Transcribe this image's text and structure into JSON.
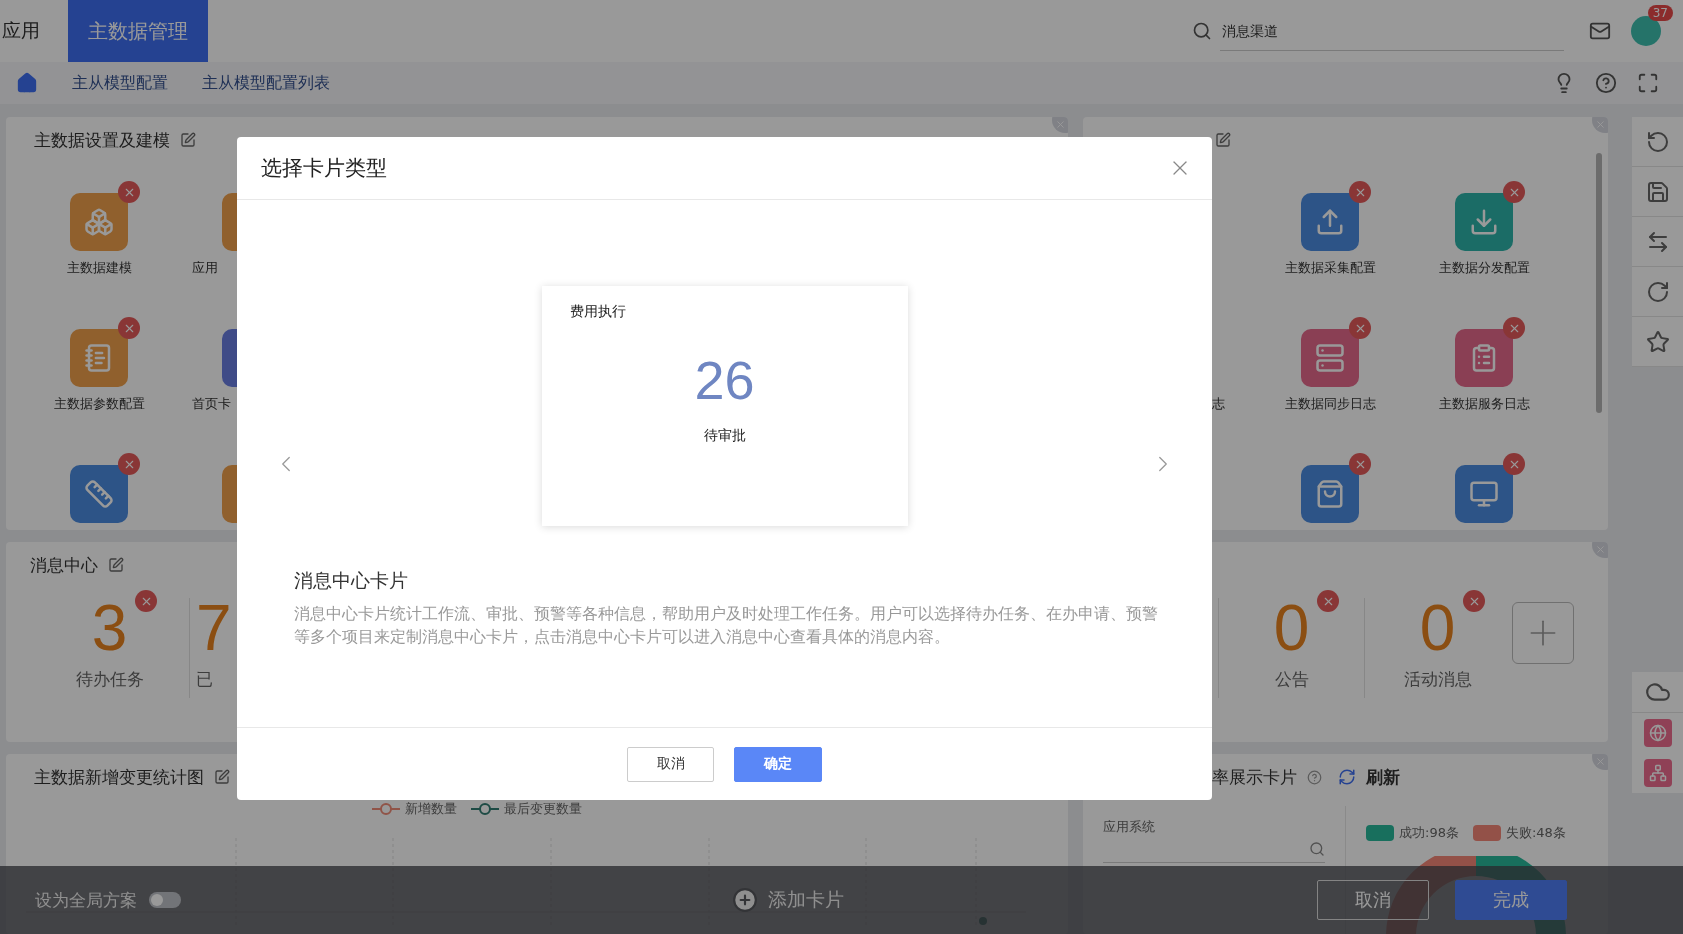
{
  "header": {
    "app_label": "应用",
    "module_tab": {
      "label": "主数据管理",
      "selected": true
    },
    "search": {
      "placeholder": "消息渠道"
    },
    "notification_badge": "37"
  },
  "breadcrumb": [
    "主从模型配置",
    "主从模型配置列表"
  ],
  "setup_panel": {
    "title": "主数据设置及建模",
    "columns": [
      [
        {
          "label": "主数据建模",
          "kind": "cubes",
          "color": "#90602d"
        },
        {
          "label": "主数据参数配置",
          "kind": "notebook",
          "color": "#90602d"
        },
        {
          "kind": "ruler",
          "color": "#2d5487"
        }
      ],
      [
        {
          "label": "应用",
          "color": "#90602d"
        },
        {
          "label": "首页卡",
          "color": "#3f4b87"
        },
        {
          "color": "#90602d"
        }
      ]
    ]
  },
  "integration_panel": {
    "partial_label": "志",
    "columns": [
      [
        {
          "label": "主数据采集配置",
          "kind": "upload",
          "color": "#2d5487"
        },
        {
          "label": "主数据同步日志",
          "kind": "server",
          "color": "#8a3f54"
        },
        {
          "kind": "bag",
          "color": "#2d5487"
        }
      ],
      [
        {
          "label": "主数据分发配置",
          "kind": "download",
          "color": "#1b6c66"
        },
        {
          "label": "主数据服务日志",
          "kind": "clipboard",
          "color": "#8a3f54"
        },
        {
          "kind": "monitor",
          "color": "#2d5487"
        }
      ]
    ]
  },
  "message_panel": {
    "title": "消息中心",
    "left_items": [
      {
        "count": "3",
        "label": "待办任务"
      },
      {
        "count": "7",
        "label": "已"
      }
    ],
    "right_items": [
      {
        "count": "0",
        "label": "公告"
      },
      {
        "count": "0",
        "label": "活动消息"
      }
    ]
  },
  "chart_panel": {
    "title": "主数据新增变更统计图",
    "legend": [
      {
        "label": "新增数量",
        "color": "#905448"
      },
      {
        "label": "最后变更数量",
        "color": "#1e4b45"
      }
    ]
  },
  "rate_panel": {
    "title": "率展示卡片",
    "refresh": "刷新",
    "filter_label": "应用系统",
    "legend": [
      {
        "label": "成功:98条",
        "color": "#186f5d"
      },
      {
        "label": "失败:48条",
        "color": "#935148"
      }
    ]
  },
  "bottom_bar": {
    "global_toggle": {
      "label": "设为全局方案",
      "on": false
    },
    "add_card": "添加卡片",
    "buttons": [
      "取消",
      "完成"
    ]
  },
  "modal": {
    "title": "选择卡片类型",
    "preview": {
      "title": "费用执行",
      "count": "26",
      "label": "待审批"
    },
    "description_title": "消息中心卡片",
    "description": "消息中心卡片统计工作流、审批、预警等各种信息，帮助用户及时处理工作任务。用户可以选择待办任务、在办申请、预警等多个项目来定制消息中心卡片，点击消息中心卡片可以进入消息中心查看具体的消息内容。",
    "cancel": "取消",
    "confirm": "确定"
  }
}
